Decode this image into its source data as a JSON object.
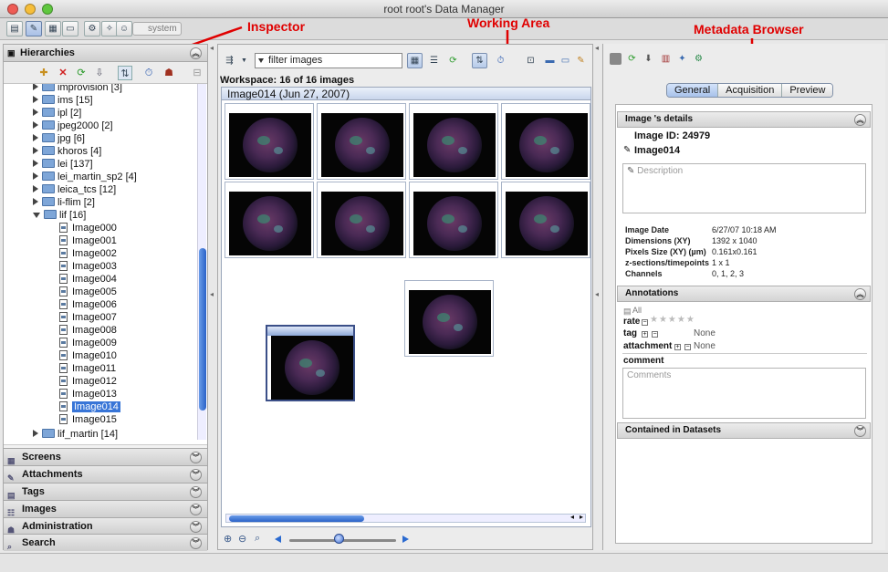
{
  "window": {
    "title": "root root's Data Manager"
  },
  "toolbar": {
    "group_label": "system"
  },
  "annotations": {
    "inspector": "Inspector",
    "working_area": "Working Area",
    "metadata_browser": "Metadata Browser"
  },
  "hierarchies": {
    "title": "Hierarchies",
    "tree": [
      {
        "label": "improvision [3]",
        "kind": "folder",
        "expanded": false
      },
      {
        "label": "ims [15]",
        "kind": "folder",
        "expanded": false
      },
      {
        "label": "ipl [2]",
        "kind": "folder",
        "expanded": false
      },
      {
        "label": "jpeg2000 [2]",
        "kind": "folder",
        "expanded": false
      },
      {
        "label": "jpg [6]",
        "kind": "folder",
        "expanded": false
      },
      {
        "label": "khoros [4]",
        "kind": "folder",
        "expanded": false
      },
      {
        "label": "lei [137]",
        "kind": "folder",
        "expanded": false
      },
      {
        "label": "lei_martin_sp2 [4]",
        "kind": "folder",
        "expanded": false
      },
      {
        "label": "leica_tcs [12]",
        "kind": "folder",
        "expanded": false
      },
      {
        "label": "li-flim [2]",
        "kind": "folder",
        "expanded": false
      },
      {
        "label": "lif [16]",
        "kind": "folder",
        "expanded": true
      }
    ],
    "images": [
      "Image000",
      "Image001",
      "Image002",
      "Image003",
      "Image004",
      "Image005",
      "Image006",
      "Image007",
      "Image008",
      "Image009",
      "Image010",
      "Image011",
      "Image012",
      "Image013",
      "Image014",
      "Image015"
    ],
    "selected_image": "Image014",
    "after": {
      "label": "lif_martin [14]"
    }
  },
  "accordion": [
    "Screens",
    "Attachments",
    "Tags",
    "Images",
    "Administration",
    "Search"
  ],
  "workspace": {
    "filter_placeholder": "filter  images",
    "label": "Workspace: 16 of 16 images",
    "group_header": "Image014 (Jun 27, 2007)",
    "thumbnail_count": 10,
    "scroll_position": 0.0,
    "zoom_level": 0.44
  },
  "metadata": {
    "tabs": [
      {
        "label": "General",
        "active": true
      },
      {
        "label": "Acquisition",
        "active": false
      },
      {
        "label": "Preview",
        "active": false
      }
    ],
    "details_header": "Image 's details",
    "image_id": "Image  ID: 24979",
    "image_name": "Image014",
    "description_placeholder": "Description",
    "fields": [
      {
        "key": "Image Date",
        "value": "6/27/07 10:18 AM"
      },
      {
        "key": "Dimensions (XY)",
        "value": "1392 x 1040"
      },
      {
        "key": "Pixels Size (XY) (µm)",
        "value": "0.161x0.161"
      },
      {
        "key": "z-sections/timepoints",
        "value": "1 x 1"
      },
      {
        "key": "Channels",
        "value": "0, 1, 2, 3"
      }
    ],
    "annotations_header": "Annotations",
    "all_label": "All",
    "rate_label": "rate",
    "rate_value": 0,
    "stars": "★★★★★",
    "tag_label": "tag",
    "tag_value": "None",
    "attachment_label": "attachment",
    "attachment_value": "None",
    "comment_label": "comment",
    "comment_placeholder": "Comments",
    "datasets_header": "Contained in Datasets"
  },
  "colors": {
    "selection": "#3875d7",
    "annotation_red": "#e00000",
    "tab_active": "#a8c2ea"
  }
}
